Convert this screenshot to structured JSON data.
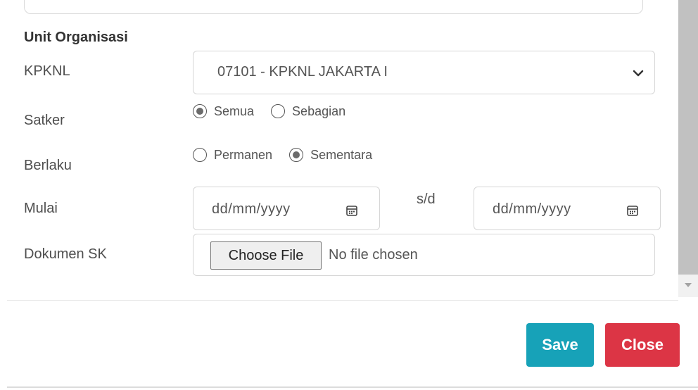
{
  "form": {
    "section_title": "Unit Organisasi",
    "kpknl": {
      "label": "KPKNL",
      "selected_value": "07101 - KPKNL JAKARTA I"
    },
    "satker": {
      "label": "Satker",
      "options": [
        {
          "label": "Semua",
          "checked": true
        },
        {
          "label": "Sebagian",
          "checked": false
        }
      ]
    },
    "berlaku": {
      "label": "Berlaku",
      "options": [
        {
          "label": "Permanen",
          "checked": false
        },
        {
          "label": "Sementara",
          "checked": true
        }
      ]
    },
    "mulai": {
      "label": "Mulai",
      "start_placeholder": "dd/mm/yyyy",
      "separator": "s/d",
      "end_placeholder": "dd/mm/yyyy"
    },
    "dokumen_sk": {
      "label": "Dokumen SK",
      "button_label": "Choose File",
      "file_status": "No file chosen"
    }
  },
  "footer": {
    "save_label": "Save",
    "close_label": "Close",
    "save_color": "#17a2b8",
    "close_color": "#dc3545"
  },
  "icons": {
    "select_chevron": "chevron-down-icon",
    "date_picker": "calendar-icon",
    "scroll_down": "scroll-down-arrow-icon"
  }
}
